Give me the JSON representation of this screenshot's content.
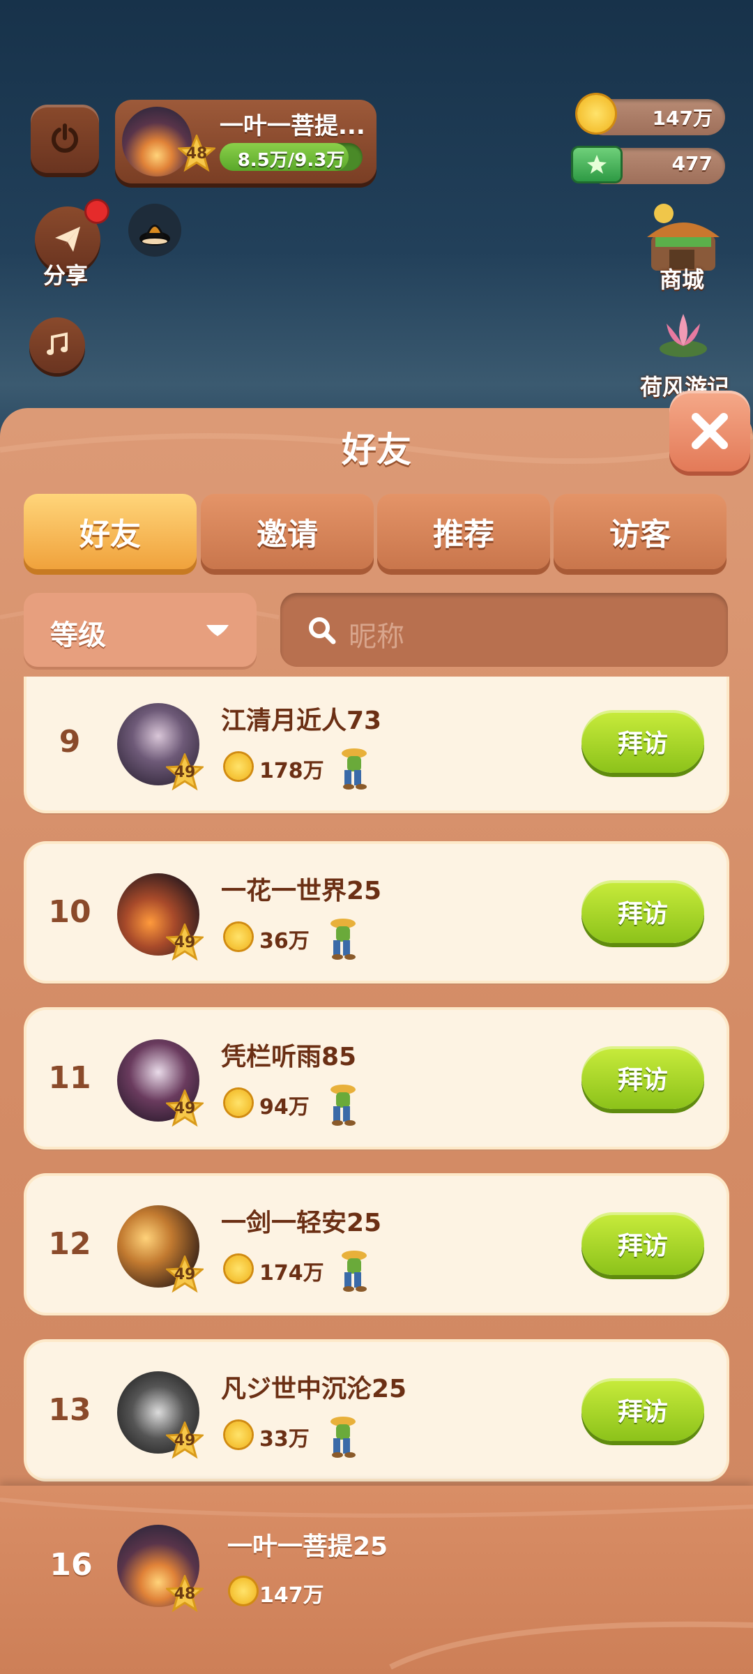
{
  "hud": {
    "player_name": "一叶一菩提...",
    "player_level": "48",
    "exp_text": "8.5万/9.3万",
    "share_label": "分享",
    "coins": "147万",
    "cash": "477",
    "shop_label": "商城",
    "event_label": "荷风游记"
  },
  "panel": {
    "title": "好友",
    "tabs": [
      {
        "label": "好友",
        "active": true
      },
      {
        "label": "邀请",
        "active": false
      },
      {
        "label": "推荐",
        "active": false
      },
      {
        "label": "访客",
        "active": false
      }
    ],
    "sort_label": "等级",
    "search_placeholder": "昵称",
    "visit_label": "拜访"
  },
  "friends": [
    {
      "rank": "9",
      "name": "江清月近人73",
      "level": "49",
      "coins": "178万"
    },
    {
      "rank": "10",
      "name": "一花一世界25",
      "level": "49",
      "coins": "36万"
    },
    {
      "rank": "11",
      "name": "凭栏听雨85",
      "level": "49",
      "coins": "94万"
    },
    {
      "rank": "12",
      "name": "一剑一轻安25",
      "level": "49",
      "coins": "174万"
    },
    {
      "rank": "13",
      "name": "凡ジ世中沉沦25",
      "level": "49",
      "coins": "33万"
    }
  ],
  "self_row": {
    "rank": "16",
    "name": "一叶一菩提25",
    "level": "48",
    "coins": "147万"
  }
}
